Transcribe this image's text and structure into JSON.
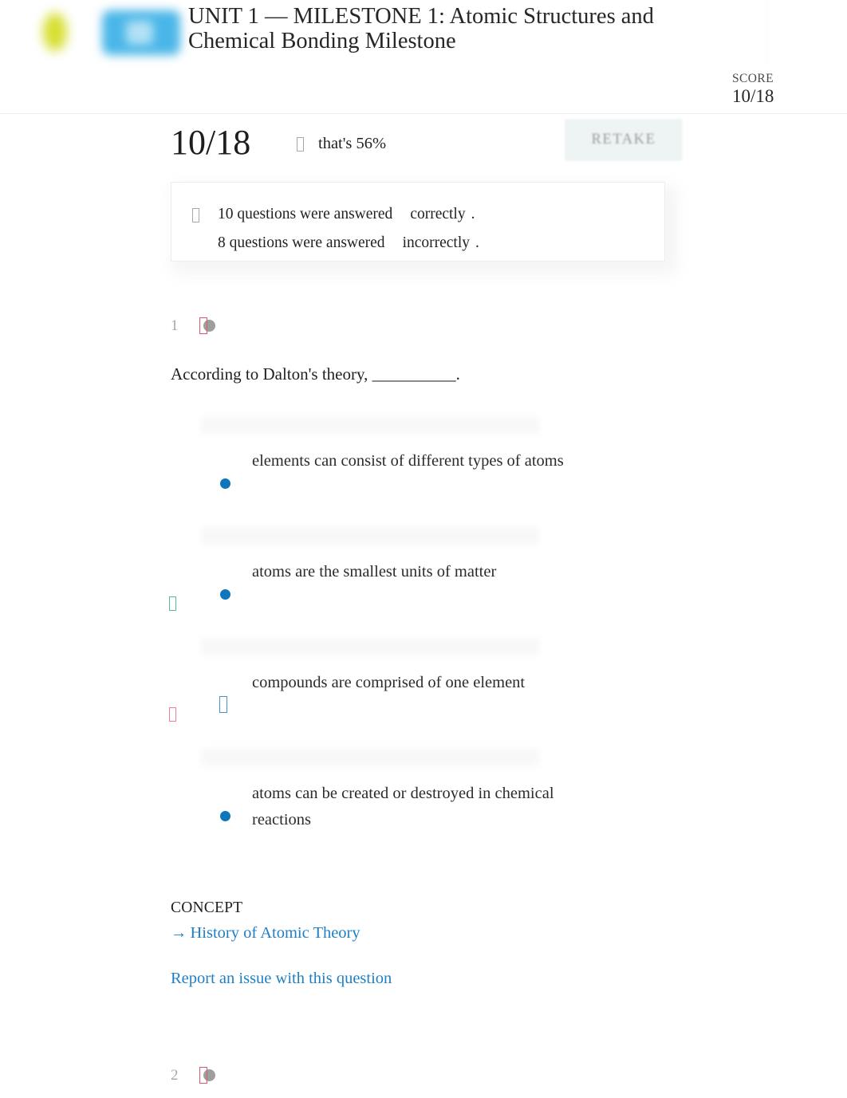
{
  "header": {
    "logo": {
      "blob_color": "#d4dd26",
      "tile_color": "#4ab6e8"
    },
    "title": "UNIT 1 — MILESTONE 1: Atomic Structures and Chemical Bonding Milestone",
    "score_label": "SCORE",
    "score_value": "10/18"
  },
  "result": {
    "big_score": "10/18",
    "percent_text": "that's 56%",
    "percent_icon": "missing-glyph-box",
    "retake_label": "RETAKE"
  },
  "summary": {
    "icon": "missing-glyph-box",
    "lines": [
      {
        "count": "10",
        "middle": "questions were answered",
        "verdict": "correctly",
        "period": "."
      },
      {
        "count": "8",
        "middle": "questions were answered",
        "verdict": "incorrectly",
        "period": "."
      }
    ]
  },
  "question": {
    "number": "1",
    "mark_icon": "incorrect-mark",
    "text": "According to Dalton's theory, __________.",
    "options": [
      {
        "text": "elements can consist of different types of atoms",
        "side_mark": "none",
        "bullet": "dot"
      },
      {
        "text": "atoms are the smallest units of matter",
        "side_mark": "correct",
        "bullet": "dot"
      },
      {
        "text": "compounds are comprised of one element",
        "side_mark": "incorrect",
        "bullet": "selected"
      },
      {
        "text": "atoms can be created or destroyed in chemical reactions",
        "side_mark": "none",
        "bullet": "dot"
      }
    ],
    "concept_label": "CONCEPT",
    "concept_link": "History of Atomic Theory",
    "concept_arrow": "→",
    "report_link": "Report an issue with this question"
  },
  "next_question": {
    "number": "2",
    "mark_icon": "incorrect-mark"
  },
  "colors": {
    "link": "#1f7fc4",
    "bullet": "#0f76bc",
    "correct": "#5cb894",
    "incorrect": "#ee8090",
    "selected": "#4a90c8"
  }
}
